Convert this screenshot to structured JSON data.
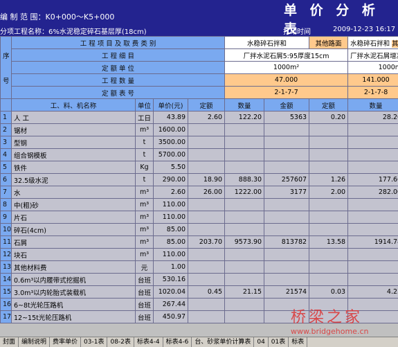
{
  "header": {
    "scope_label": "编 制 范 围：K0+000～K5+000",
    "project_label": "分项工程名称：6%水泥稳定碎石基层厚(18cm)",
    "title": "单 价 分 析 表",
    "print_label": "打印时间",
    "print_time": "2009-12-23 16:17"
  },
  "table": {
    "seq_label": "序",
    "seq_label2": "号",
    "row_labels": {
      "category": "工 程 项 目 及 取 费 类 别",
      "detail": "工 程 细 目",
      "unit": "定 额 单 位",
      "quantity": "工 程 数 量",
      "table_no": "定 额 表 号"
    },
    "col1": {
      "category": "水稳碎石拌和",
      "category2": "其他路面",
      "detail": "厂拌水泥石屑5:95厚度15cm",
      "unit": "1000m²",
      "quantity": "47.000",
      "table_no": "2-1-7-7"
    },
    "col2": {
      "category": "水稳碎石拌和",
      "category2": "其他",
      "detail": "厂拌水泥石屑增减1",
      "unit": "1000m",
      "quantity": "141.000",
      "table_no": "2-1-7-8"
    },
    "headers": {
      "item": "工、料、机名称",
      "unit": "单位",
      "price": "单价(元)",
      "quota": "定额",
      "qty": "数量",
      "amount": "金额",
      "quota2": "定额",
      "qty2": "数量"
    },
    "rows": [
      {
        "no": "1",
        "name": "人  工",
        "unit": "工日",
        "price": "43.89",
        "q1": "2.60",
        "n1": "122.20",
        "a1": "5363",
        "q2": "0.20",
        "n2": "28.20"
      },
      {
        "no": "2",
        "name": "锯材",
        "unit": "m³",
        "price": "1600.00",
        "q1": "",
        "n1": "",
        "a1": "",
        "q2": "",
        "n2": ""
      },
      {
        "no": "3",
        "name": "型钢",
        "unit": "t",
        "price": "3500.00",
        "q1": "",
        "n1": "",
        "a1": "",
        "q2": "",
        "n2": ""
      },
      {
        "no": "4",
        "name": "组合钢模板",
        "unit": "t",
        "price": "5700.00",
        "q1": "",
        "n1": "",
        "a1": "",
        "q2": "",
        "n2": ""
      },
      {
        "no": "5",
        "name": "铁件",
        "unit": "Kg",
        "price": "5.50",
        "q1": "",
        "n1": "",
        "a1": "",
        "q2": "",
        "n2": ""
      },
      {
        "no": "6",
        "name": "32.5级水泥",
        "unit": "t",
        "price": "290.00",
        "q1": "18.90",
        "n1": "888.30",
        "a1": "257607",
        "q2": "1.26",
        "n2": "177.66"
      },
      {
        "no": "7",
        "name": "水",
        "unit": "m³",
        "price": "2.60",
        "q1": "26.00",
        "n1": "1222.00",
        "a1": "3177",
        "q2": "2.00",
        "n2": "282.00"
      },
      {
        "no": "8",
        "name": "中(粗)砂",
        "unit": "m³",
        "price": "110.00",
        "q1": "",
        "n1": "",
        "a1": "",
        "q2": "",
        "n2": ""
      },
      {
        "no": "9",
        "name": "片石",
        "unit": "m³",
        "price": "110.00",
        "q1": "",
        "n1": "",
        "a1": "",
        "q2": "",
        "n2": ""
      },
      {
        "no": "10",
        "name": "碎石(4cm)",
        "unit": "m³",
        "price": "85.00",
        "q1": "",
        "n1": "",
        "a1": "",
        "q2": "",
        "n2": ""
      },
      {
        "no": "11",
        "name": "石屑",
        "unit": "m³",
        "price": "85.00",
        "q1": "203.70",
        "n1": "9573.90",
        "a1": "813782",
        "q2": "13.58",
        "n2": "1914.78"
      },
      {
        "no": "12",
        "name": "块石",
        "unit": "m³",
        "price": "110.00",
        "q1": "",
        "n1": "",
        "a1": "",
        "q2": "",
        "n2": ""
      },
      {
        "no": "13",
        "name": "其他材料费",
        "unit": "元",
        "price": "1.00",
        "q1": "",
        "n1": "",
        "a1": "",
        "q2": "",
        "n2": ""
      },
      {
        "no": "14",
        "name": "0.6m³以内履带式挖掘机",
        "unit": "台班",
        "price": "530.16",
        "q1": "",
        "n1": "",
        "a1": "",
        "q2": "",
        "n2": ""
      },
      {
        "no": "15",
        "name": "3.0m³以内轮胎式装载机",
        "unit": "台班",
        "price": "1020.04",
        "q1": "0.45",
        "n1": "21.15",
        "a1": "21574",
        "q2": "0.03",
        "n2": "4.23"
      },
      {
        "no": "16",
        "name": "6~8t光轮压路机",
        "unit": "台班",
        "price": "267.44",
        "q1": "",
        "n1": "",
        "a1": "",
        "q2": "",
        "n2": ""
      },
      {
        "no": "17",
        "name": "12~15t光轮压路机",
        "unit": "台班",
        "price": "450.97",
        "q1": "",
        "n1": "",
        "a1": "",
        "q2": "",
        "n2": ""
      }
    ]
  },
  "tabs": [
    "封面",
    "编制说明",
    "费率单价",
    "03-1表",
    "08-2表",
    "标表4-4",
    "标表4-6",
    "台、砂浆单价计算表",
    "04",
    "01表",
    "标表"
  ],
  "watermark": {
    "logo": "桥梁之家",
    "url": "www.bridgehome.cn"
  }
}
